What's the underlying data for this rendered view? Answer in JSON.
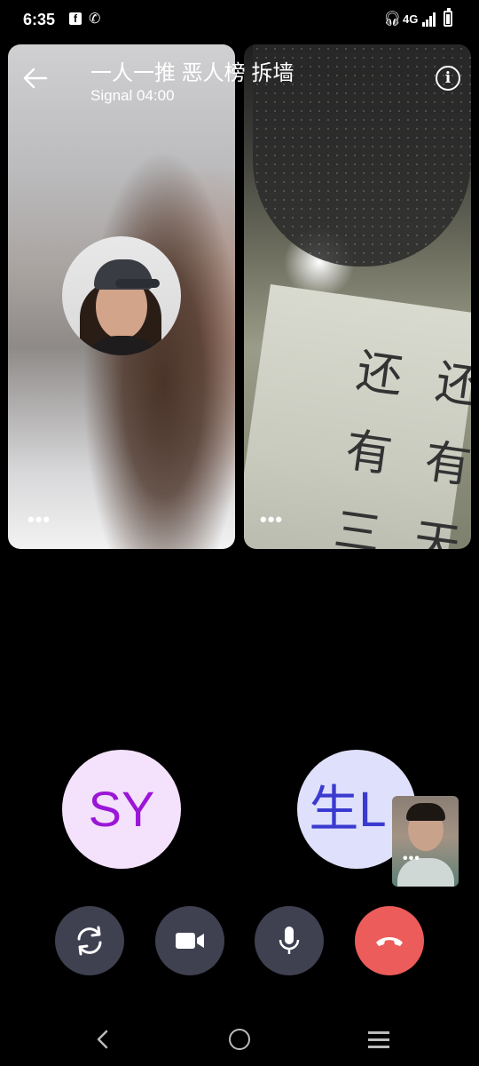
{
  "status_bar": {
    "time": "6:35",
    "network": "4G"
  },
  "header": {
    "title": "一人一推 恶人榜 拆墙",
    "subtitle": "Signal 04:00"
  },
  "tiles": {
    "left_more": "•••",
    "right_more": "•••"
  },
  "right_tile_writing": [
    "还",
    "有",
    "三",
    "还",
    "有",
    "天"
  ],
  "participants": [
    {
      "initials": "SY",
      "bg": "#f4e1fb",
      "fg": "#9b16d6"
    },
    {
      "initials": "生L",
      "bg": "#dfe0fb",
      "fg": "#3a3ad0"
    }
  ],
  "self_preview_more": "•••",
  "controls": [
    {
      "name": "flip-camera",
      "icon": "flip-camera-icon"
    },
    {
      "name": "video",
      "icon": "video-camera-icon"
    },
    {
      "name": "mic",
      "icon": "microphone-icon"
    },
    {
      "name": "end-call",
      "icon": "hangup-icon",
      "color": "#ec5c5a"
    }
  ],
  "colors": {
    "control_bg": "#3f4050",
    "end_call": "#ec5c5a",
    "background": "#000000"
  }
}
